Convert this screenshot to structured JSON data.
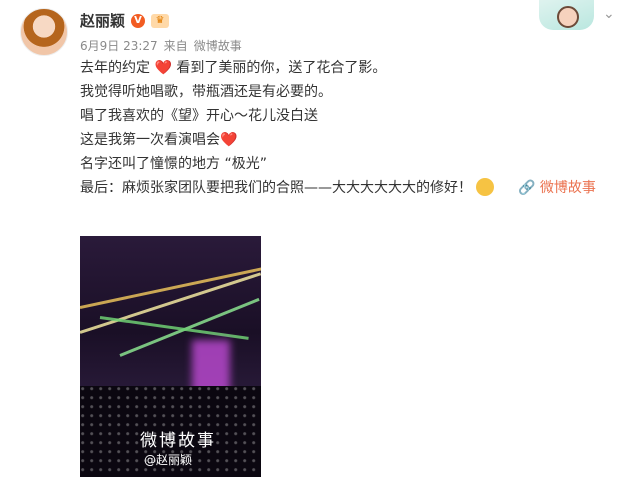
{
  "post": {
    "username": "赵丽颖",
    "badge_v": "V",
    "badge_vip": "♛",
    "meta": {
      "date": "6月9日 23:27",
      "source_prefix": "来自",
      "source": "微博故事"
    },
    "lines": [
      {
        "text": "去年的约定 ",
        "heart": "❤️",
        "text2": " 看到了美丽的你，送了花合了影。"
      },
      {
        "text": "我觉得听她唱歌，带瓶酒还是有必要的。"
      },
      {
        "text": "唱了我喜欢的《望》开心～花儿没白送"
      },
      {
        "text": "这是我第一次看演唱会",
        "heart": "❤️"
      },
      {
        "text": "名字还叫了憧憬的地方 “极光”"
      },
      {
        "text": "最后：麻烦张家团队要把我们的合照——大大大大大大的修好！"
      }
    ],
    "source_link": "🔗 微博故事",
    "video": {
      "watermark": "微博故事",
      "handle": "@赵丽颖"
    }
  },
  "icons": {
    "more": "chevron-down-icon",
    "avatar": "avatar-image",
    "emoji": "smiling-face-emoji"
  }
}
